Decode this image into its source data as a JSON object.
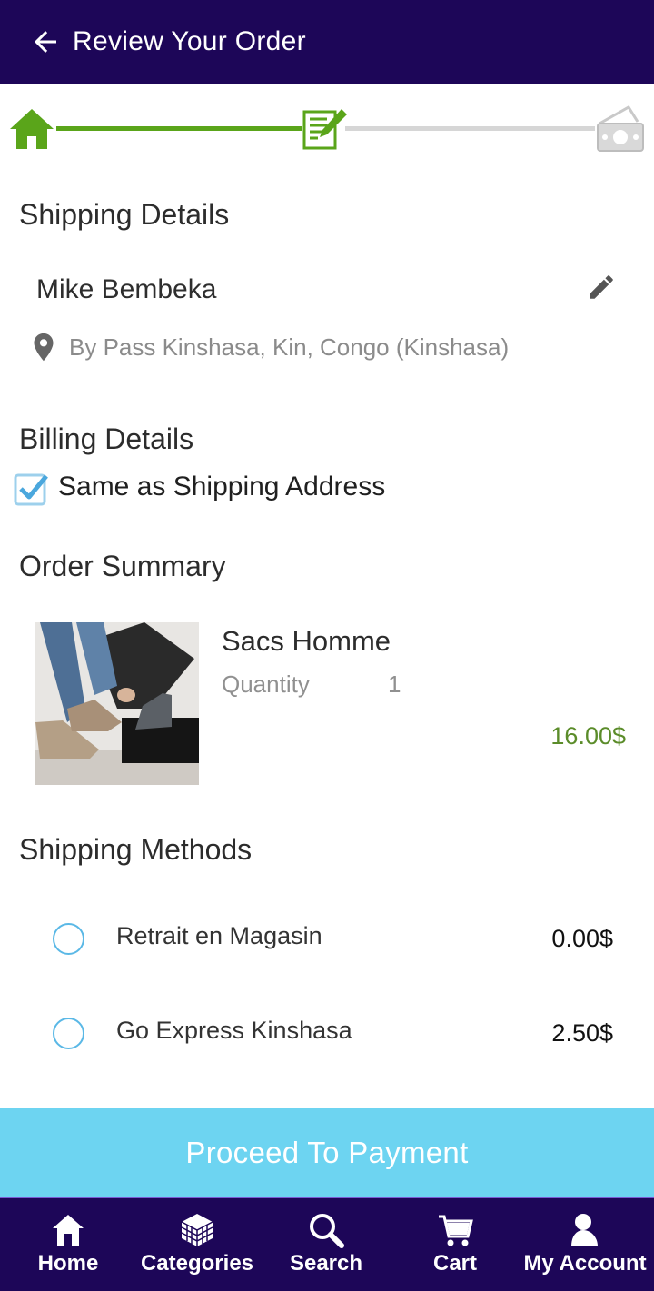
{
  "header": {
    "title": "Review Your Order",
    "back_icon": "arrow-left-icon"
  },
  "stepper": {
    "steps": [
      {
        "icon": "home-icon",
        "state": "done"
      },
      {
        "icon": "edit-document-icon",
        "state": "current"
      },
      {
        "icon": "money-icon",
        "state": "pending"
      }
    ],
    "colors": {
      "done": "#5aa51a",
      "pending": "#d6d6d6"
    }
  },
  "shipping": {
    "title": "Shipping Details",
    "name": "Mike Bembeka",
    "address": "By Pass  Kinshasa, Kin, Congo (Kinshasa)"
  },
  "billing": {
    "title": "Billing Details",
    "same_as_shipping_label": "Same as Shipping Address",
    "same_as_shipping_checked": true
  },
  "order_summary": {
    "title": "Order Summary",
    "items": [
      {
        "name": "Sacs Homme",
        "quantity_label": "Quantity",
        "quantity": "1",
        "price": "16.00$"
      }
    ]
  },
  "shipping_methods": {
    "title": "Shipping Methods",
    "options": [
      {
        "name": "Retrait en Magasin",
        "price": "0.00$",
        "selected": false
      },
      {
        "name": "Go Express Kinshasa",
        "price": "2.50$",
        "selected": false
      }
    ]
  },
  "proceed_button": "Proceed To Payment",
  "bottom_nav": [
    {
      "label": "Home",
      "icon": "home-icon"
    },
    {
      "label": "Categories",
      "icon": "cube-icon"
    },
    {
      "label": "Search",
      "icon": "search-icon"
    },
    {
      "label": "Cart",
      "icon": "cart-icon"
    },
    {
      "label": "My Account",
      "icon": "user-icon"
    }
  ],
  "colors": {
    "primary": "#1d0658",
    "accent": "#6dd4f1",
    "price": "#5b8c2a"
  }
}
